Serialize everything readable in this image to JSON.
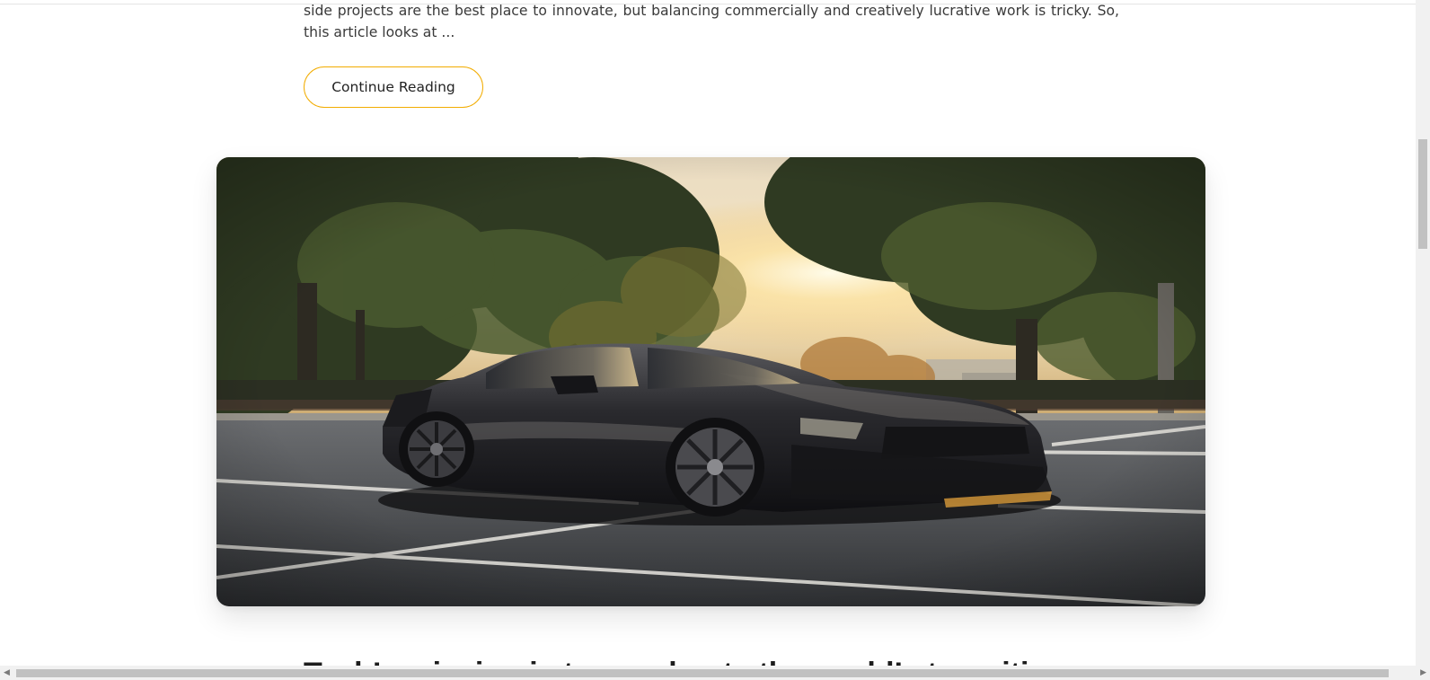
{
  "post_previous": {
    "excerpt": "side projects are the best place to innovate, but balancing commercially and creatively lucrative work is tricky. So, this article looks at ...",
    "continue_label": "Continue Reading"
  },
  "post_next": {
    "image_icon": "featured-photo-black-muscle-car-parking-lot-sunset",
    "title": "Tech’s mission is to accelerate the world’s transition"
  },
  "scrollbars": {
    "left_arrow": "◀",
    "right_arrow": "▶"
  },
  "colors": {
    "accent": "#f2ac00",
    "text": "#3a3a3a",
    "heading": "#1c1c1c"
  }
}
